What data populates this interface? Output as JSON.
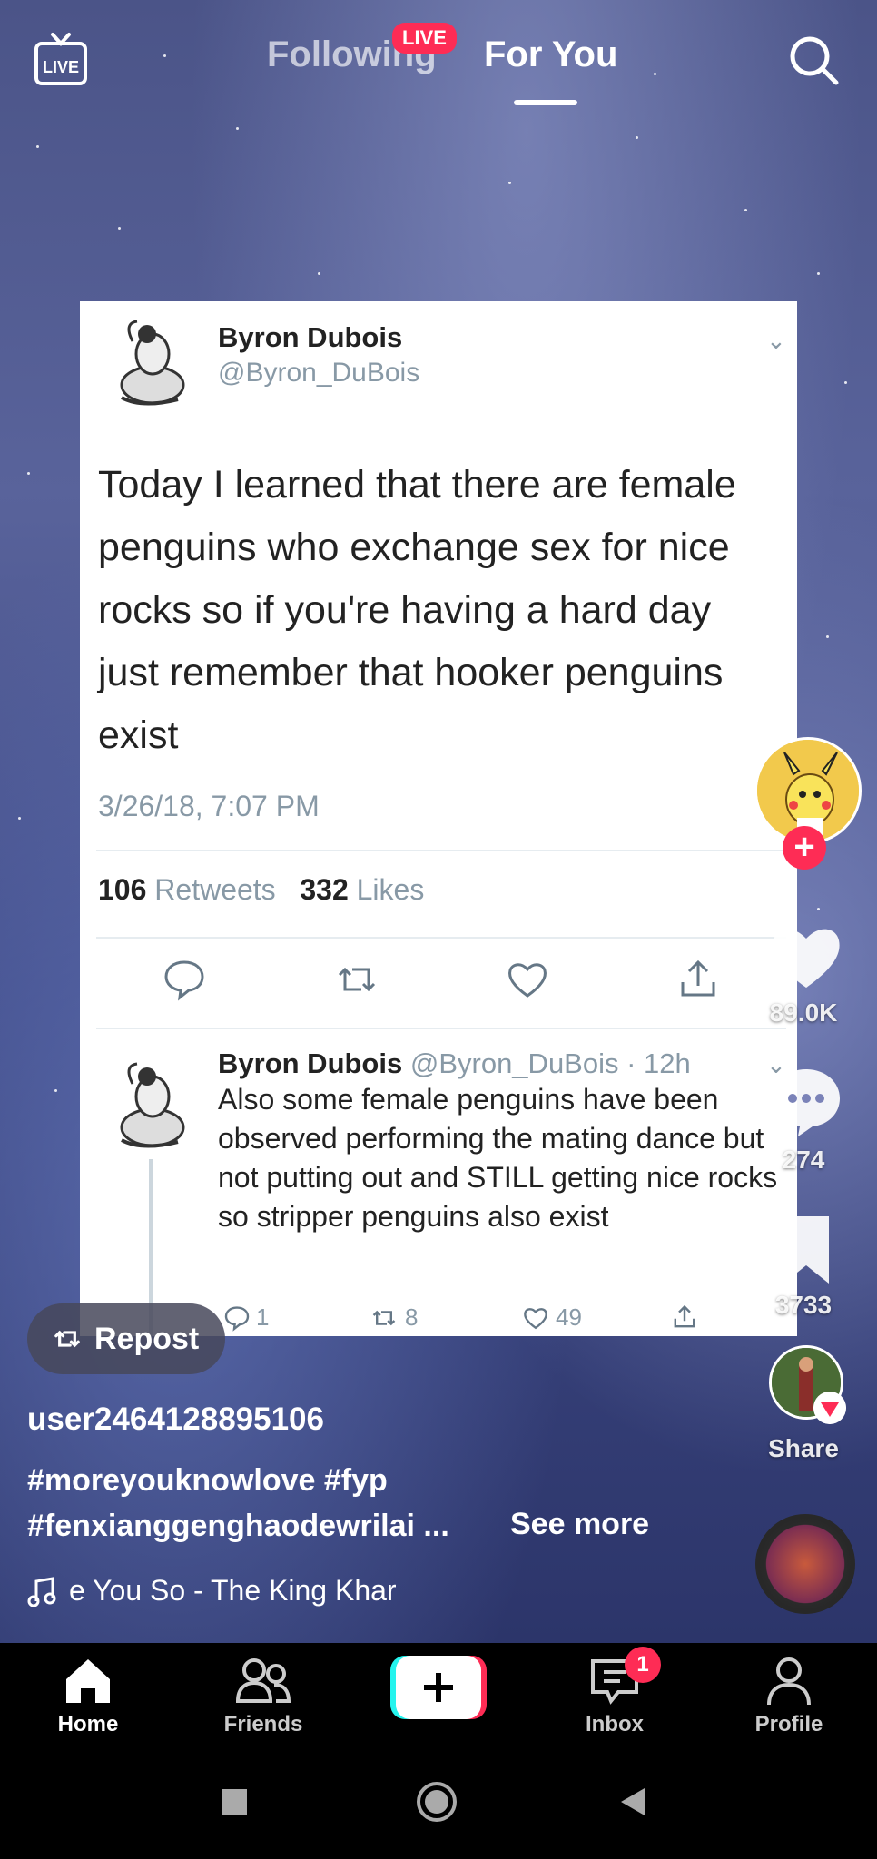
{
  "top_bar": {
    "tabs": [
      "Following",
      "For You"
    ],
    "live_badge": "LIVE"
  },
  "tweet": {
    "author": "Byron Dubois",
    "handle": "@Byron_DuBois",
    "text": "Today I learned that there are female penguins who exchange sex for nice rocks so if you're having a hard day just remember that hooker penguins exist",
    "date": "3/26/18, 7:07 PM",
    "retweets": "106",
    "retweets_label": "Retweets",
    "likes": "332",
    "likes_label": "Likes",
    "reply": {
      "author": "Byron Dubois",
      "handle_time": "@Byron_DuBois · 12h",
      "text": "Also some female penguins have been observed performing the mating dance but not putting out and STILL getting nice rocks so stripper penguins also exist",
      "replies": "1",
      "retweets": "8",
      "likes": "49"
    }
  },
  "rail": {
    "likes": "89.0K",
    "comments": "274",
    "saves": "3733",
    "share_label": "Share"
  },
  "post": {
    "repost_label": "Repost",
    "username": "user2464128895106",
    "caption_line1": "#moreyouknowlove #fyp",
    "caption_line2": "#fenxianggenghaodewrilai ...",
    "see_more": "See more",
    "music": "e You So - The King Khar"
  },
  "nav": {
    "items": [
      "Home",
      "Friends",
      "Inbox",
      "Profile"
    ],
    "inbox_badge": "1"
  },
  "colors": {
    "accent": "#fe2c55",
    "cyan": "#25f4ee"
  }
}
